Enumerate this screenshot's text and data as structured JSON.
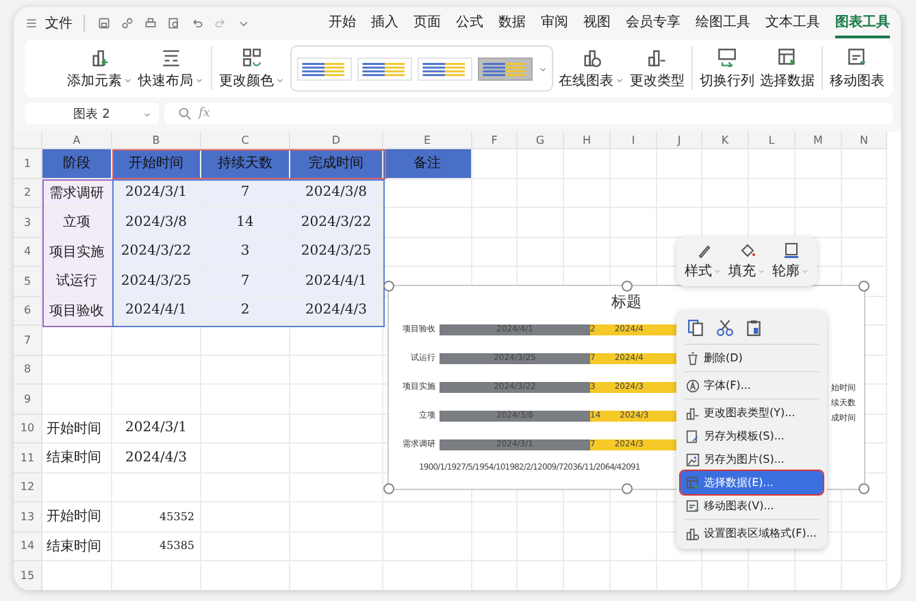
{
  "title_bar": {
    "file_menu": "文件",
    "tabs": [
      {
        "label": "开始",
        "selected": false
      },
      {
        "label": "插入",
        "selected": false
      },
      {
        "label": "页面",
        "selected": false
      },
      {
        "label": "公式",
        "selected": false
      },
      {
        "label": "数据",
        "selected": false
      },
      {
        "label": "审阅",
        "selected": false
      },
      {
        "label": "视图",
        "selected": false
      },
      {
        "label": "会员专享",
        "selected": false
      },
      {
        "label": "绘图工具",
        "selected": false
      },
      {
        "label": "文本工具",
        "selected": false
      },
      {
        "label": "图表工具",
        "selected": true
      }
    ]
  },
  "ribbon": {
    "tools_left": [
      {
        "label": "添加元素",
        "dropdown": true
      },
      {
        "label": "快速布局",
        "dropdown": true
      },
      {
        "label": "更改颜色",
        "dropdown": true
      }
    ],
    "styles": [
      {
        "selected": false
      },
      {
        "selected": false
      },
      {
        "selected": false
      },
      {
        "selected": true
      }
    ],
    "tools_right": [
      {
        "label": "在线图表",
        "dropdown": true
      },
      {
        "label": "更改类型",
        "dropdown": false
      },
      {
        "label": "切换行列",
        "dropdown": false
      },
      {
        "label": "选择数据",
        "dropdown": false
      },
      {
        "label": "移动图表",
        "dropdown": false
      }
    ]
  },
  "formula_bar": {
    "name_box": "图表 2",
    "function_label": "fx"
  },
  "columns": [
    "A",
    "B",
    "C",
    "D",
    "E",
    "F",
    "G",
    "H",
    "I",
    "J",
    "K",
    "L",
    "M",
    "N"
  ],
  "rows": [
    {
      "number": "1",
      "kind": "header",
      "cells": [
        "阶段",
        "开始时间",
        "持续天数",
        "完成时间",
        "备注"
      ]
    },
    {
      "number": "2",
      "kind": "data",
      "cells": [
        "需求调研",
        "2024/3/1",
        "7",
        "2024/3/8"
      ]
    },
    {
      "number": "3",
      "kind": "data",
      "cells": [
        "立项",
        "2024/3/8",
        "14",
        "2024/3/22"
      ]
    },
    {
      "number": "4",
      "kind": "data",
      "cells": [
        "项目实施",
        "2024/3/22",
        "3",
        "2024/3/25"
      ]
    },
    {
      "number": "5",
      "kind": "data",
      "cells": [
        "试运行",
        "2024/3/25",
        "7",
        "2024/4/1"
      ]
    },
    {
      "number": "6",
      "kind": "data",
      "cells": [
        "项目验收",
        "2024/4/1",
        "2",
        "2024/4/3"
      ]
    },
    {
      "number": "7",
      "kind": "empty",
      "cells": []
    },
    {
      "number": "8",
      "kind": "empty",
      "cells": []
    },
    {
      "number": "9",
      "kind": "empty",
      "cells": []
    },
    {
      "number": "10",
      "kind": "date",
      "cells": [
        "开始时间",
        "2024/3/1"
      ]
    },
    {
      "number": "11",
      "kind": "date",
      "cells": [
        "结束时间",
        "2024/4/3"
      ]
    },
    {
      "number": "12",
      "kind": "empty",
      "cells": []
    },
    {
      "number": "13",
      "kind": "number",
      "cells": [
        "开始时间",
        "45352"
      ]
    },
    {
      "number": "14",
      "kind": "number",
      "cells": [
        "结束时间",
        "45385"
      ]
    },
    {
      "number": "15",
      "kind": "empty",
      "cells": []
    }
  ],
  "chart": {
    "title": "标题",
    "bars": [
      {
        "category": "项目验收",
        "start_label": "2024/4/1",
        "days_label": "2",
        "end_label": "2024/4"
      },
      {
        "category": "试运行",
        "start_label": "2024/3/25",
        "days_label": "7",
        "end_label": "2024/4"
      },
      {
        "category": "项目实施",
        "start_label": "2024/3/22",
        "days_label": "3",
        "end_label": "2024/3"
      },
      {
        "category": "立项",
        "start_label": "2024/3/8",
        "days_label": "14",
        "end_label": "2024/3"
      },
      {
        "category": "需求调研",
        "start_label": "2024/3/1",
        "days_label": "7",
        "end_label": "2024/3"
      }
    ],
    "axis_labels": "1900/1/1927/5/1954/101982/2/12009/72036/11/2064/42091",
    "legend": [
      "始时间",
      "续天数",
      "成时间"
    ]
  },
  "float_toolbar": [
    {
      "label": "样式"
    },
    {
      "label": "填充"
    },
    {
      "label": "轮廓"
    }
  ],
  "context_menu": {
    "items": [
      {
        "label": "删除(D)",
        "selected": false,
        "separator_after": true
      },
      {
        "label": "字体(F)...",
        "selected": false,
        "separator_after": true
      },
      {
        "label": "更改图表类型(Y)...",
        "selected": false,
        "separator_after": false
      },
      {
        "label": "另存为模板(S)...",
        "selected": false,
        "separator_after": false
      },
      {
        "label": "另存为图片(S)...",
        "selected": false,
        "separator_after": false
      },
      {
        "label": "选择数据(E)...",
        "selected": true,
        "separator_after": false
      },
      {
        "label": "移动图表(V)...",
        "selected": false,
        "separator_after": true
      },
      {
        "label": "设置图表区域格式(F)...",
        "selected": false,
        "separator_after": false
      }
    ]
  }
}
